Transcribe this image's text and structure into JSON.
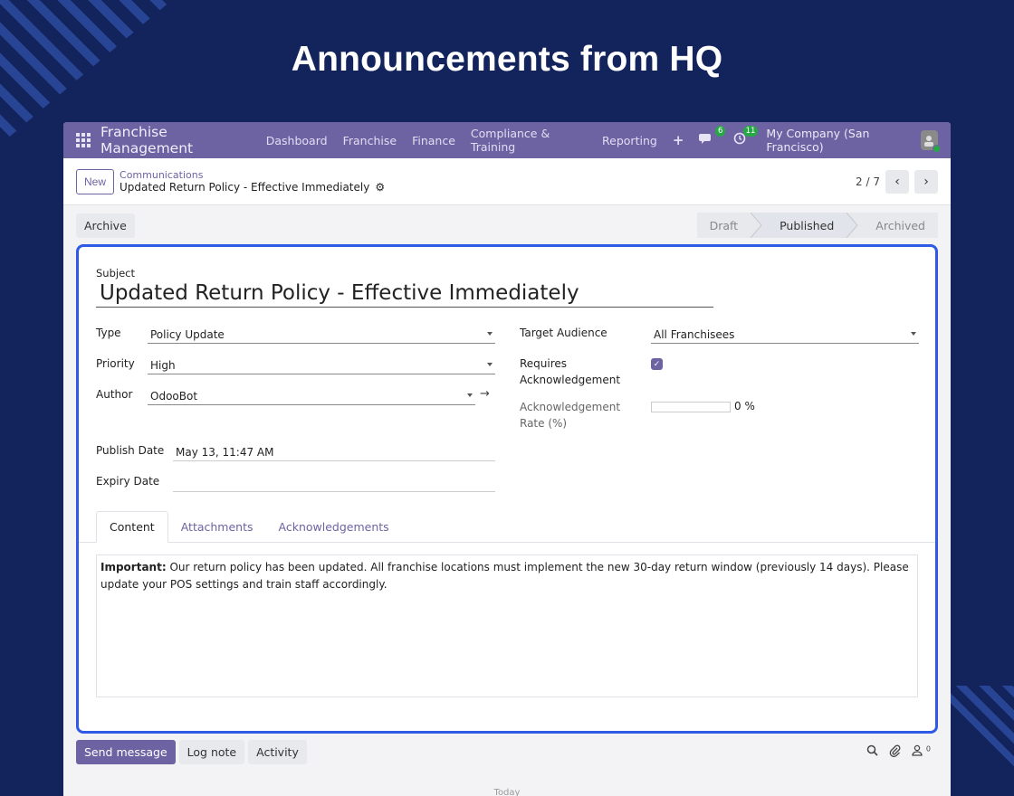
{
  "hero": {
    "title": "Announcements from HQ"
  },
  "navbar": {
    "brand": "Franchise Management",
    "menu": [
      "Dashboard",
      "Franchise",
      "Finance",
      "Compliance & Training",
      "Reporting"
    ],
    "plus": "+",
    "messages_count": "6",
    "activities_count": "11",
    "company": "My Company (San Francisco)"
  },
  "control": {
    "new_label": "New",
    "breadcrumb_parent": "Communications",
    "breadcrumb_current": "Updated Return Policy - Effective Immediately",
    "pager": "2 / 7"
  },
  "status": {
    "archive_label": "Archive",
    "stages": [
      "Draft",
      "Published",
      "Archived"
    ],
    "active_stage": "Published"
  },
  "form": {
    "subject_label": "Subject",
    "subject": "Updated Return Policy - Effective Immediately",
    "type_label": "Type",
    "type": "Policy Update",
    "priority_label": "Priority",
    "priority": "High",
    "author_label": "Author",
    "author": "OdooBot",
    "publish_date_label": "Publish Date",
    "publish_date": "May 13, 11:47 AM",
    "expiry_date_label": "Expiry Date",
    "expiry_date": "",
    "target_audience_label": "Target Audience",
    "target_audience": "All Franchisees",
    "requires_ack_label_1": "Requires",
    "requires_ack_label_2": "Acknowledgement",
    "requires_ack": true,
    "ack_rate_label_1": "Acknowledgement",
    "ack_rate_label_2": "Rate (%)",
    "ack_rate": 0,
    "ack_rate_text": "0 %"
  },
  "tabs": [
    "Content",
    "Attachments",
    "Acknowledgements"
  ],
  "content": {
    "important": "Important:",
    "body": " Our return policy has been updated. All franchise locations must implement the new 30-day return window (previously 14 days). Please update your POS settings and train staff accordingly."
  },
  "chatter": {
    "send_message": "Send message",
    "log_note": "Log note",
    "activity": "Activity",
    "followers_count": "0",
    "today": "Today"
  },
  "colors": {
    "brand": "#6d63a3",
    "focus": "#2e5ae6",
    "background": "#13245c"
  }
}
